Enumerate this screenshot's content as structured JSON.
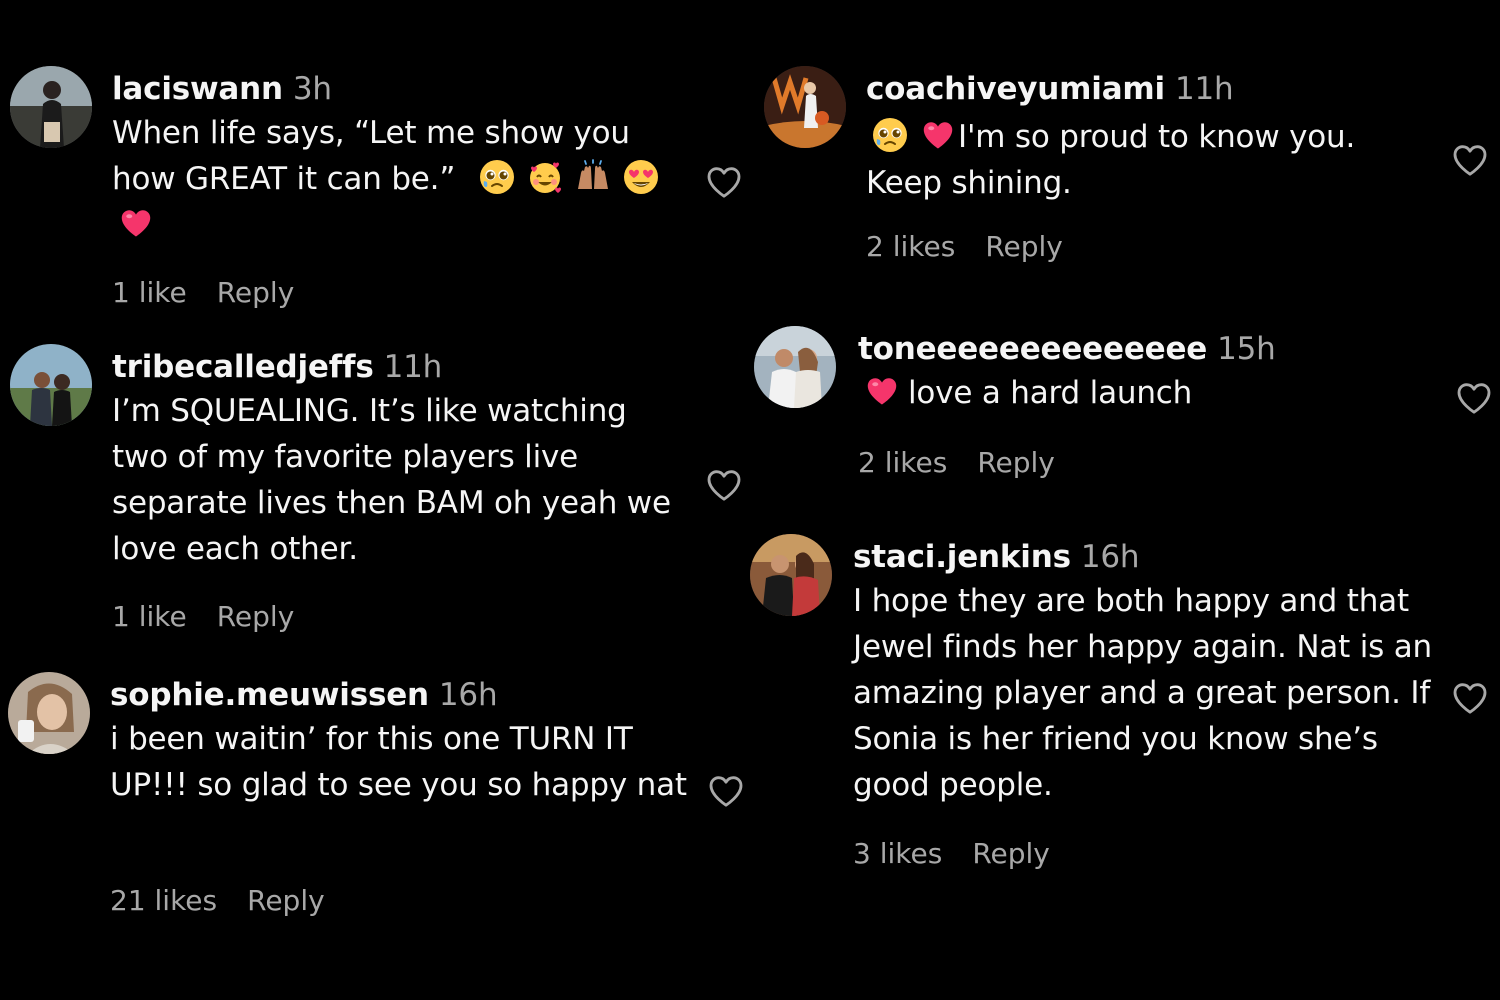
{
  "colors": {
    "background": "#000000",
    "text": "#f5f5f5",
    "muted": "#a8a8a8",
    "heart_emoji": "#f5356b"
  },
  "comments": [
    {
      "username": "laciswann",
      "time": "3h",
      "text": "When life says, “Let me show you how GREAT it can be.”",
      "emojis": [
        "pleading-face",
        "smiling-face-with-hearts",
        "raising-hands",
        "heart-eyes",
        "pink-heart"
      ],
      "likes": "1 like",
      "reply": "Reply"
    },
    {
      "username": "tribecalledjeffs",
      "time": "11h",
      "text": "I’m SQUEALING. It’s like watching two of my favorite players live separate lives then BAM oh yeah we love each other.",
      "likes": "1 like",
      "reply": "Reply"
    },
    {
      "username": "sophie.meuwissen",
      "time": "16h",
      "text": "i been waitin’ for this one TURN IT UP!!! so glad to see you so happy nat",
      "likes": "21 likes",
      "reply": "Reply"
    },
    {
      "username": "coachiveyumiami",
      "time": "11h",
      "emojis": [
        "pleading-face",
        "pink-heart"
      ],
      "text": "I'm so proud to know you. Keep shining.",
      "likes": "2 likes",
      "reply": "Reply"
    },
    {
      "username": "toneeeeeeeeeeeeee",
      "time": "15h",
      "emojis": [
        "pink-heart"
      ],
      "text": "love a hard launch",
      "likes": "2 likes",
      "reply": "Reply"
    },
    {
      "username": "staci.jenkins",
      "time": "16h",
      "text": "I hope they are both happy and that Jewel finds her happy again. Nat is an amazing player and a great person. If Sonia is her friend you know she’s good people.",
      "likes": "3 likes",
      "reply": "Reply"
    }
  ]
}
